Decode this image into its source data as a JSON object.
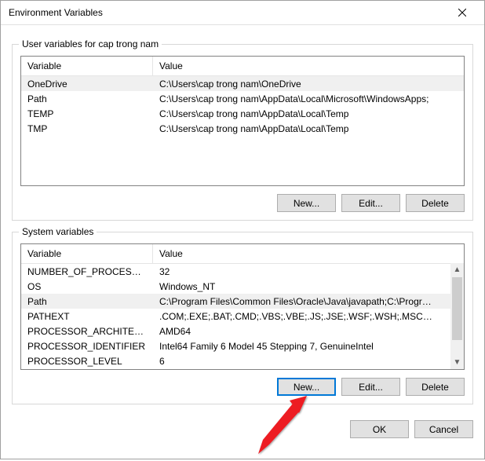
{
  "window": {
    "title": "Environment Variables"
  },
  "user_section": {
    "legend": "User variables for cap trong nam",
    "headers": {
      "variable": "Variable",
      "value": "Value"
    },
    "rows": [
      {
        "variable": "OneDrive",
        "value": "C:\\Users\\cap trong nam\\OneDrive"
      },
      {
        "variable": "Path",
        "value": "C:\\Users\\cap trong nam\\AppData\\Local\\Microsoft\\WindowsApps;"
      },
      {
        "variable": "TEMP",
        "value": "C:\\Users\\cap trong nam\\AppData\\Local\\Temp"
      },
      {
        "variable": "TMP",
        "value": "C:\\Users\\cap trong nam\\AppData\\Local\\Temp"
      }
    ],
    "selected_index": 0,
    "buttons": {
      "new": "New...",
      "edit": "Edit...",
      "delete": "Delete"
    }
  },
  "system_section": {
    "legend": "System variables",
    "headers": {
      "variable": "Variable",
      "value": "Value"
    },
    "rows": [
      {
        "variable": "NUMBER_OF_PROCESSORS",
        "value": "32"
      },
      {
        "variable": "OS",
        "value": "Windows_NT"
      },
      {
        "variable": "Path",
        "value": "C:\\Program Files\\Common Files\\Oracle\\Java\\javapath;C:\\Program ..."
      },
      {
        "variable": "PATHEXT",
        "value": ".COM;.EXE;.BAT;.CMD;.VBS;.VBE;.JS;.JSE;.WSF;.WSH;.MSC;.PY;.PYW"
      },
      {
        "variable": "PROCESSOR_ARCHITECTURE",
        "value": "AMD64"
      },
      {
        "variable": "PROCESSOR_IDENTIFIER",
        "value": "Intel64 Family 6 Model 45 Stepping 7, GenuineIntel"
      },
      {
        "variable": "PROCESSOR_LEVEL",
        "value": "6"
      }
    ],
    "selected_index": 2,
    "buttons": {
      "new": "New...",
      "edit": "Edit...",
      "delete": "Delete"
    },
    "focused_button": "new"
  },
  "dialog_buttons": {
    "ok": "OK",
    "cancel": "Cancel"
  },
  "annotation": {
    "arrow_color": "#ed1c24",
    "arrow_target": "system-new-button"
  }
}
